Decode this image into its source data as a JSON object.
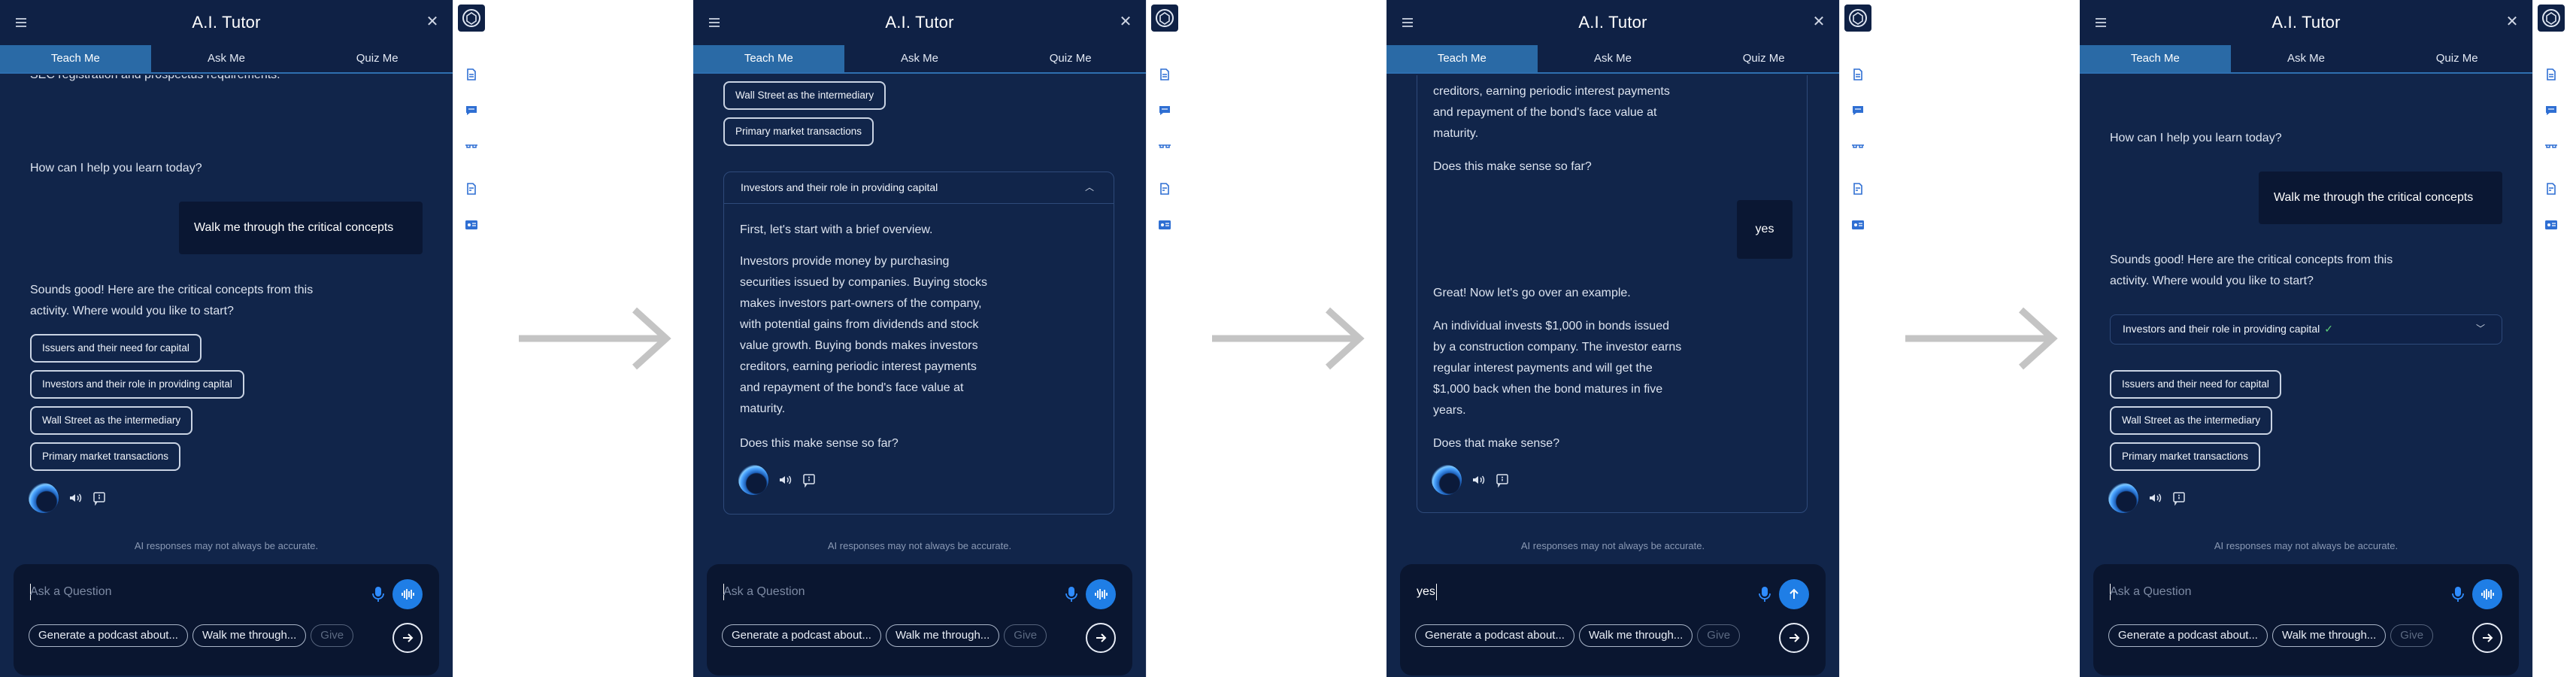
{
  "app": {
    "title": "A.I. Tutor",
    "tabs": [
      "Teach Me",
      "Ask Me",
      "Quiz Me"
    ],
    "disclaimer": "AI responses may not always be accurate.",
    "input_placeholder": "Ask a Question",
    "suggestions": [
      "Generate a podcast about...",
      "Walk me through...",
      "Give"
    ]
  },
  "colors": {
    "panel_bg": "#11254a",
    "active_tab": "#2a6aa6",
    "accent_blue": "#1f7ee6",
    "check_green": "#5fd07a"
  },
  "icons": [
    "menu-icon",
    "close-icon",
    "microphone-icon",
    "voice-wave-icon",
    "send-arrow-icon",
    "next-arrow-icon",
    "speaker-icon",
    "feedback-icon",
    "document-icon",
    "chat-icon",
    "glasses-icon",
    "report-icon",
    "id-card-icon"
  ],
  "screen1": {
    "partial_text": "SEC registration and prospectus requirements.",
    "prompt": "How can I help you learn today?",
    "user_msg": "Walk me through the critical concepts",
    "reply": "Sounds good! Here are the critical concepts from this activity. Where would you like to start?",
    "chips": [
      "Issuers and their need for capital",
      "Investors and their role in providing capital",
      "Wall Street as the intermediary",
      "Primary market transactions"
    ]
  },
  "screen2": {
    "chips": [
      "Wall Street as the intermediary",
      "Primary market transactions"
    ],
    "card_title": "Investors and their role in providing capital",
    "overview": "First, let's start with a brief overview.",
    "paragraph": [
      "Investors provide money by purchasing",
      "securities issued by companies. Buying stocks",
      "makes investors part-owners of the company,",
      "with potential gains from dividends and stock",
      "value growth. Buying bonds makes investors",
      "creditors, earning periodic interest payments",
      "and repayment of the bond's face value at",
      "maturity."
    ],
    "question": "Does this make sense so far?"
  },
  "screen3": {
    "lines_top": [
      "creditors, earning periodic interest payments",
      "and repayment of the bond's face value at",
      "maturity."
    ],
    "question": "Does this make sense so far?",
    "user_reply": "yes",
    "example_intro": "Great! Now let's go over an example.",
    "example": [
      "An individual invests $1,000 in bonds issued",
      "by a construction company. The investor earns",
      "regular interest payments and will get the",
      "$1,000 back when the bond matures in five",
      "years."
    ],
    "question2": "Does that make sense?",
    "input_value": "yes"
  },
  "screen4": {
    "prompt": "How can I help you learn today?",
    "user_msg": "Walk me through the critical concepts",
    "reply": "Sounds good! Here are the critical concepts from this activity. Where would you like to start?",
    "completed_topic": "Investors and their role in providing capital",
    "chips": [
      "Issuers and their need for capital",
      "Wall Street as the intermediary",
      "Primary market transactions"
    ]
  }
}
